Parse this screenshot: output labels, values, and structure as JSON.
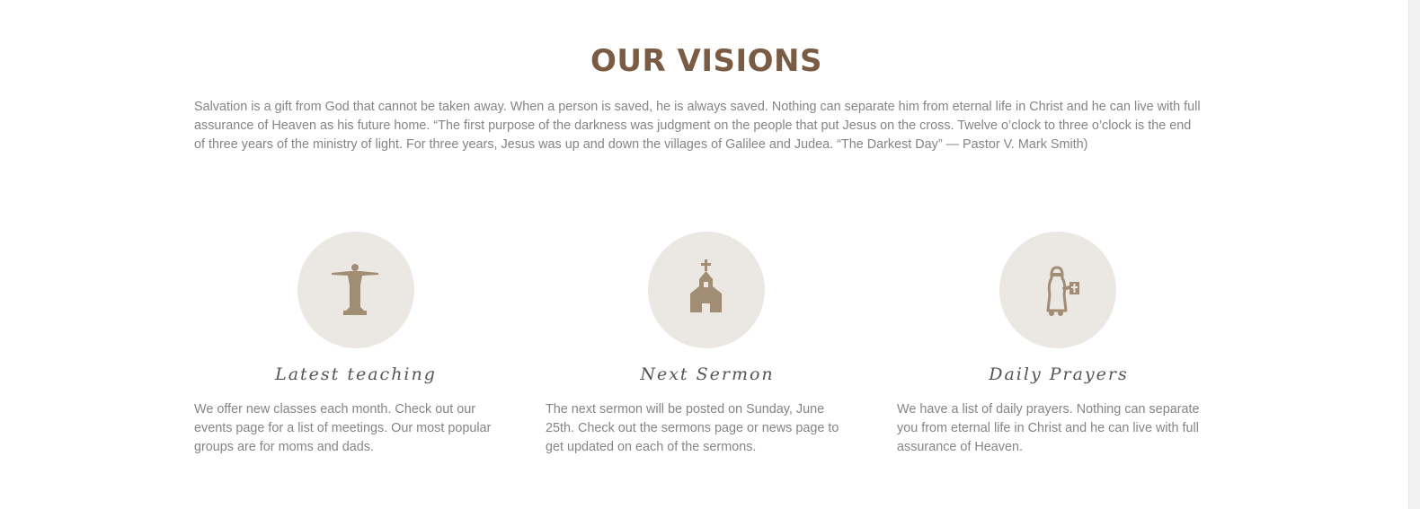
{
  "visions": {
    "title": "OUR VISIONS",
    "intro": "Salvation is a gift from God that cannot be taken away. When a person is saved, he is always saved. Nothing can separate him from eternal life in Christ and he can live with full assurance of Heaven as his future home. “The first purpose of the darkness was judgment on the people that put Jesus on the cross. Twelve o’clock to three o’clock is the end of three years of the ministry of light. For three years, Jesus was up and down the villages of Galilee and Judea. “The Darkest Day” — Pastor V. Mark Smith)"
  },
  "features": [
    {
      "icon": "christ-statue-icon",
      "title": "Latest teaching",
      "text": "We offer new classes each month. Check out our events page for a list of meetings. Our most popular groups are for moms and dads."
    },
    {
      "icon": "church-icon",
      "title": "Next Sermon",
      "text": "The next sermon will be posted on Sunday, June 25th. Check out the sermons page or news page to get updated on each of the sermons."
    },
    {
      "icon": "praying-figure-with-bible-icon",
      "title": "Daily Prayers",
      "text": "We have a list of daily prayers. Nothing can separate you from eternal life in Christ and he can live with full assurance of Heaven."
    }
  ],
  "colors": {
    "heading": "#7a5c44",
    "icon": "#a18d74",
    "circle": "#ebe7e2",
    "body_text": "#858585",
    "feature_title": "#555555"
  }
}
